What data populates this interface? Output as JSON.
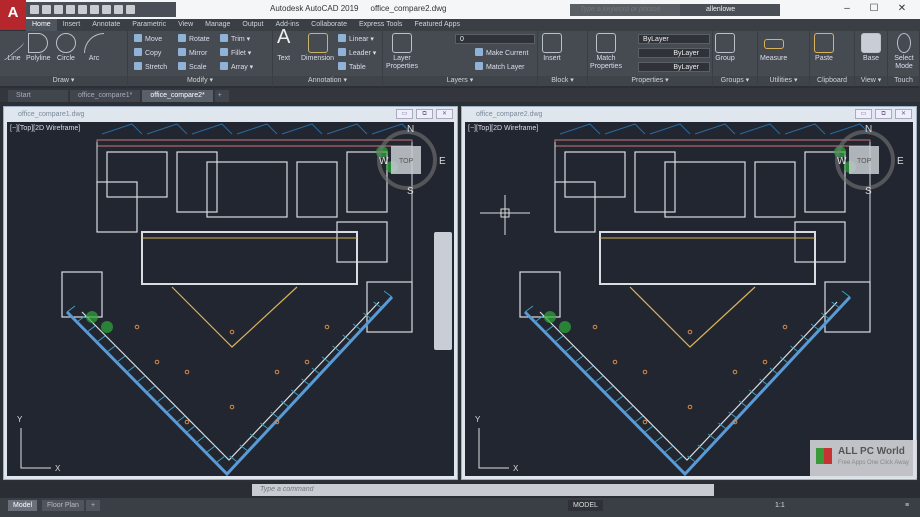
{
  "app": {
    "logo": "A",
    "title": "Autodesk AutoCAD 2019",
    "file": "office_compare2.dwg"
  },
  "search": {
    "placeholder": "Type a keyword or phrase"
  },
  "user": {
    "name": "allenlowe"
  },
  "window_controls": {
    "minimize": "–",
    "maximize": "☐",
    "close": "✕"
  },
  "ribbon_tabs": [
    "Home",
    "Insert",
    "Annotate",
    "Parametric",
    "View",
    "Manage",
    "Output",
    "Add-ins",
    "Collaborate",
    "Express Tools",
    "Featured Apps"
  ],
  "draw": {
    "label": "Draw ▾",
    "line": "Line",
    "polyline": "Polyline",
    "circle": "Circle",
    "arc": "Arc"
  },
  "modify": {
    "label": "Modify ▾",
    "move": "Move",
    "rotate": "Rotate",
    "trim": "Trim ▾",
    "copy": "Copy",
    "mirror": "Mirror",
    "fillet": "Fillet ▾",
    "stretch": "Stretch",
    "scale": "Scale",
    "array": "Array ▾"
  },
  "annotation": {
    "label": "Annotation ▾",
    "text": "Text",
    "dimension": "Dimension",
    "linear": "Linear ▾",
    "leader": "Leader ▾",
    "table": "Table"
  },
  "layers": {
    "label": "Layers ▾",
    "layer_properties": "Layer Properties",
    "current_layer": "0",
    "make_current": "Make Current",
    "match_layer": "Match Layer"
  },
  "block": {
    "label": "Block ▾",
    "insert": "Insert"
  },
  "properties": {
    "label": "Properties ▾",
    "match": "Match Properties",
    "color": "ByLayer",
    "linetype": "ByLayer",
    "lineweight": "ByLayer"
  },
  "groups": {
    "label": "Groups ▾",
    "group": "Group"
  },
  "utilities": {
    "label": "Utilities ▾",
    "measure": "Measure"
  },
  "clipboard": {
    "label": "Clipboard",
    "paste": "Paste"
  },
  "view": {
    "label": "View ▾",
    "base": "Base"
  },
  "touch": {
    "label": "Touch",
    "select_mode": "Select Mode"
  },
  "doc_tabs": [
    "Start",
    "office_compare1*",
    "office_compare2*"
  ],
  "viewports": [
    {
      "title": "office_compare1.dwg",
      "label": "[−][Top][2D Wireframe]"
    },
    {
      "title": "office_compare2.dwg",
      "label": "[−][Top][2D Wireframe]"
    }
  ],
  "viewcube": {
    "n": "N",
    "e": "E",
    "s": "S",
    "w": "W",
    "top": "TOP"
  },
  "axes": {
    "x": "X",
    "y": "Y"
  },
  "command": {
    "placeholder": "Type a command"
  },
  "layout_tabs": [
    "Model",
    "Floor Plan",
    "+"
  ],
  "status": {
    "model": "MODEL",
    "scale": "1:1"
  },
  "watermark": {
    "name": "ALL PC World",
    "tagline": "Free Apps One Click Away"
  }
}
